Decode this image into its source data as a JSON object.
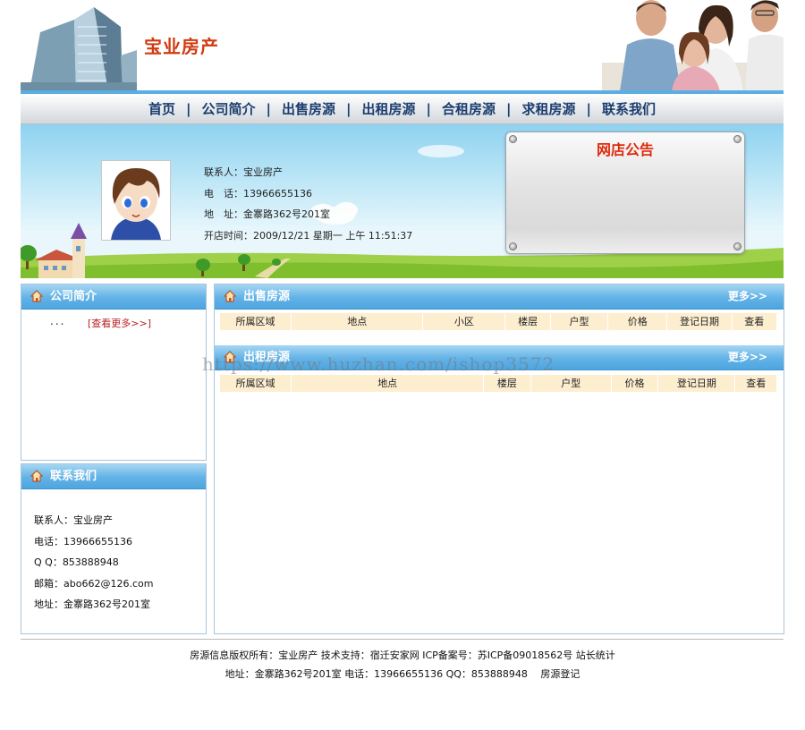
{
  "header": {
    "site_title": "宝业房产"
  },
  "nav": {
    "items": [
      "首页",
      "公司简介",
      "出售房源",
      "出租房源",
      "合租房源",
      "求租房源",
      "联系我们"
    ],
    "separator": "|"
  },
  "banner": {
    "contact_lines": [
      "联系人：宝业房产",
      "电　话：13966655136",
      "地　址：金寨路362号201室",
      "开店时间：2009/12/21 星期一 上午 11:51:37"
    ],
    "notice_title": "网店公告"
  },
  "left": {
    "about": {
      "title": "公司简介",
      "dots": "...",
      "more_label": "[查看更多>>]"
    },
    "contact": {
      "title": "联系我们",
      "lines": [
        "联系人：宝业房产",
        "电话：13966655136",
        "Q Q：853888948",
        "邮箱：abo662@126.com",
        "地址：金寨路362号201室"
      ]
    }
  },
  "right": {
    "sale": {
      "title": "出售房源",
      "more_label": "更多>>",
      "columns": [
        "所属区域",
        "地点",
        "小区",
        "楼层",
        "户型",
        "价格",
        "登记日期",
        "查看"
      ]
    },
    "rent": {
      "title": "出租房源",
      "more_label": "更多>>",
      "columns": [
        "所属区域",
        "地点",
        "楼层",
        "户型",
        "价格",
        "登记日期",
        "查看"
      ]
    }
  },
  "watermark": "https://www.huzhan.com/ishop3572",
  "footer": {
    "line1": "房源信息版权所有：宝业房产 技术支持：宿迁安家网 ICP备案号：苏ICP备09018562号 站长统计",
    "line2": "地址：金寨路362号201室 电话：13966655136 QQ：853888948 　房源登记"
  },
  "colors": {
    "accent_blue": "#4ea6df",
    "title_red": "#d03a10",
    "nav_text": "#1a3d6e",
    "grid_head_bg": "#fdeed0"
  }
}
